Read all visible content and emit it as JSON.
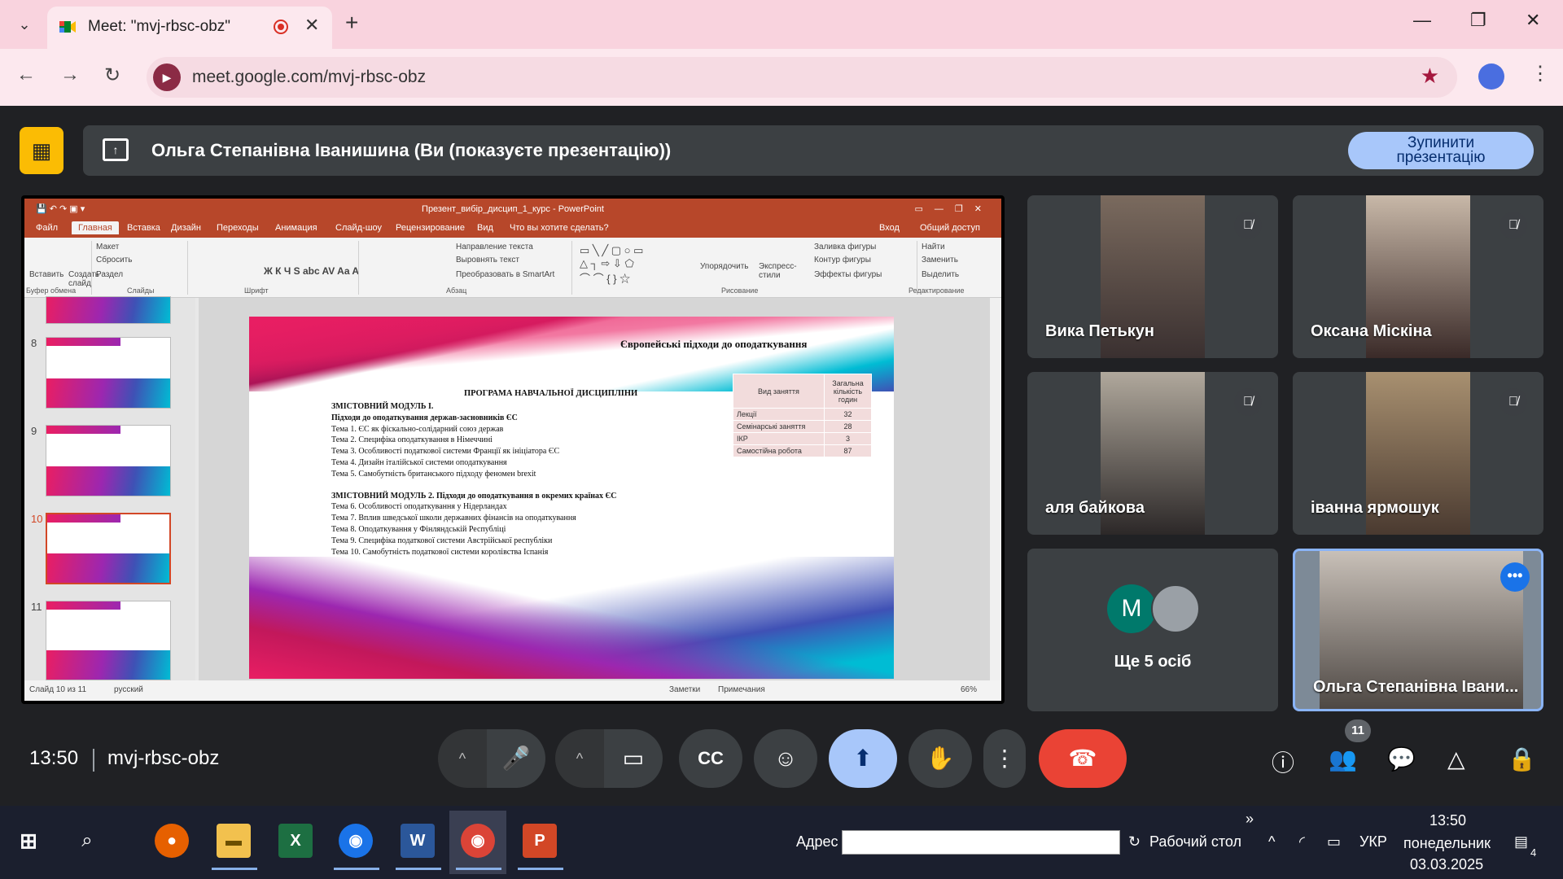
{
  "browser": {
    "tab_title": "Meet: \"mvj-rbsc-obz\"",
    "url": "meet.google.com/mvj-rbsc-obz",
    "close_glyph": "✕",
    "newtab_glyph": "+",
    "back_glyph": "←",
    "forward_glyph": "→",
    "reload_glyph": "↻",
    "star_glyph": "★",
    "min_glyph": "—",
    "max_glyph": "❐",
    "winclose_glyph": "✕",
    "dropdown_glyph": "⌄",
    "kebab_glyph": "⋮",
    "favicon_color": "#00832d"
  },
  "presentation": {
    "banner_text": "Ольга Степанівна Іванишина (Ви (показуєте презентацію))",
    "stop_button": "Зупинити презентацію",
    "stop_line1": "Зупинити",
    "stop_line2": "презентацію"
  },
  "ppt": {
    "window_title": "Презент_вибір_дисцип_1_курс - PowerPoint",
    "menu": [
      "Файл",
      "Главная",
      "Вставка",
      "Дизайн",
      "Переходы",
      "Анимация",
      "Слайд-шоу",
      "Рецензирование",
      "Вид"
    ],
    "tell_me": "Что вы хотите сделать?",
    "login": "Вход",
    "share": "Общий доступ",
    "ribbon_groups": [
      "Буфер обмена",
      "Слайды",
      "Шрифт",
      "Абзац",
      "Рисование",
      "Редактирование"
    ],
    "ribbon_labels": {
      "paste": "Вставить",
      "create_slide": "Создать слайд",
      "layout": "Макет",
      "reset": "Сбросить",
      "section": "Раздел",
      "text_direction": "Направление текста",
      "align_text": "Выровнять текст",
      "smartart": "Преобразовать в SmartArt",
      "arrange": "Упорядочить",
      "quick_styles": "Экспресс-стили",
      "shape_fill": "Заливка фигуры",
      "shape_outline": "Контур фигуры",
      "shape_effects": "Эффекты фигуры",
      "find": "Найти",
      "replace": "Заменить",
      "select": "Выделить"
    },
    "slide_numbers": [
      "8",
      "9",
      "10",
      "11"
    ],
    "selected_slide": "10",
    "status_slide": "Слайд 10 из 11",
    "status_lang": "русский",
    "status_notes": "Заметки",
    "status_comments": "Примечания",
    "zoom": "66%"
  },
  "slide": {
    "heading": "Європейські підходи до оподаткування",
    "program_title": "ПРОГРАМА НАВЧАЛЬНОЇ ДИСЦИПЛІНИ",
    "module1_title": "ЗМІСТОВНИЙ МОДУЛЬ І.",
    "module1_subtitle": "Підходи до оподаткування держав-засновників ЄС",
    "module1_topics": [
      "Тема 1. ЄС як фіскально-солідарний союз держав",
      "Тема 2. Специфіка оподаткування в Німеччині",
      "Тема 3. Особливості податкової системи Франції як ініціатора ЄС",
      "Тема 4. Дизайн італійської системи оподаткування",
      "Тема 5. Самобутність британського підходу феномен brexit"
    ],
    "module2_title": "ЗМІСТОВНИЙ МОДУЛЬ 2. Підходи до оподаткування в окремих країнах ЄС",
    "module2_topics": [
      "Тема 6. Особливості оподаткування у Нідерландах",
      "Тема 7. Вплив шведської школи державних фінансів на оподаткування",
      "Тема 8. Оподаткування у Фінляндській Республіці",
      "Тема 9. Специфіка податкової системи Австрійської республіки",
      "Тема 10. Самобутність податкової системи королівства Іспанія"
    ],
    "table": {
      "header_type": "Вид заняття",
      "header_hours": "Загальна кількість годин",
      "rows": [
        {
          "type": "Лекції",
          "hours": "32"
        },
        {
          "type": "Семінарські заняття",
          "hours": "28"
        },
        {
          "type": "ІКР",
          "hours": "3"
        },
        {
          "type": "Самостійна робота",
          "hours": "87"
        }
      ]
    }
  },
  "participants": [
    {
      "name": "Вика Петькун",
      "muted": true,
      "video_color": "#6b5a50"
    },
    {
      "name": "Оксана Міскіна",
      "muted": true,
      "video_color": "#c9a48e"
    },
    {
      "name": "аля байкова",
      "muted": true,
      "video_color": "#8a8078"
    },
    {
      "name": "іванна ярмошук",
      "muted": true,
      "video_color": "#9a8a78"
    }
  ],
  "more_people": {
    "initial": "M",
    "label": "Ще 5 осіб"
  },
  "self_tile": {
    "name": "Ольга Степанівна Івани...",
    "dots": "•••"
  },
  "meeting": {
    "time": "13:50",
    "code": "mvj-rbsc-obz",
    "participant_count": "11",
    "mic_glyph": "🎤",
    "cam_glyph": "▭",
    "cc_glyph": "CC",
    "emoji_glyph": "☺",
    "hand_glyph": "✋",
    "more_glyph": "⋮",
    "hang_glyph": "☎",
    "info_glyph": "ⓘ",
    "people_glyph": "👥",
    "chat_glyph": "💬",
    "activities_glyph": "△",
    "lock_glyph": "🔒",
    "chevron_glyph": "^"
  },
  "taskbar": {
    "address_label": "Адрес",
    "desktop_label": "Рабочий стол",
    "lang": "УКР",
    "time": "13:50",
    "day": "понедельник",
    "date": "03.03.2025",
    "notif_count": "4",
    "expand_glyph": "»",
    "up_glyph": "^"
  }
}
